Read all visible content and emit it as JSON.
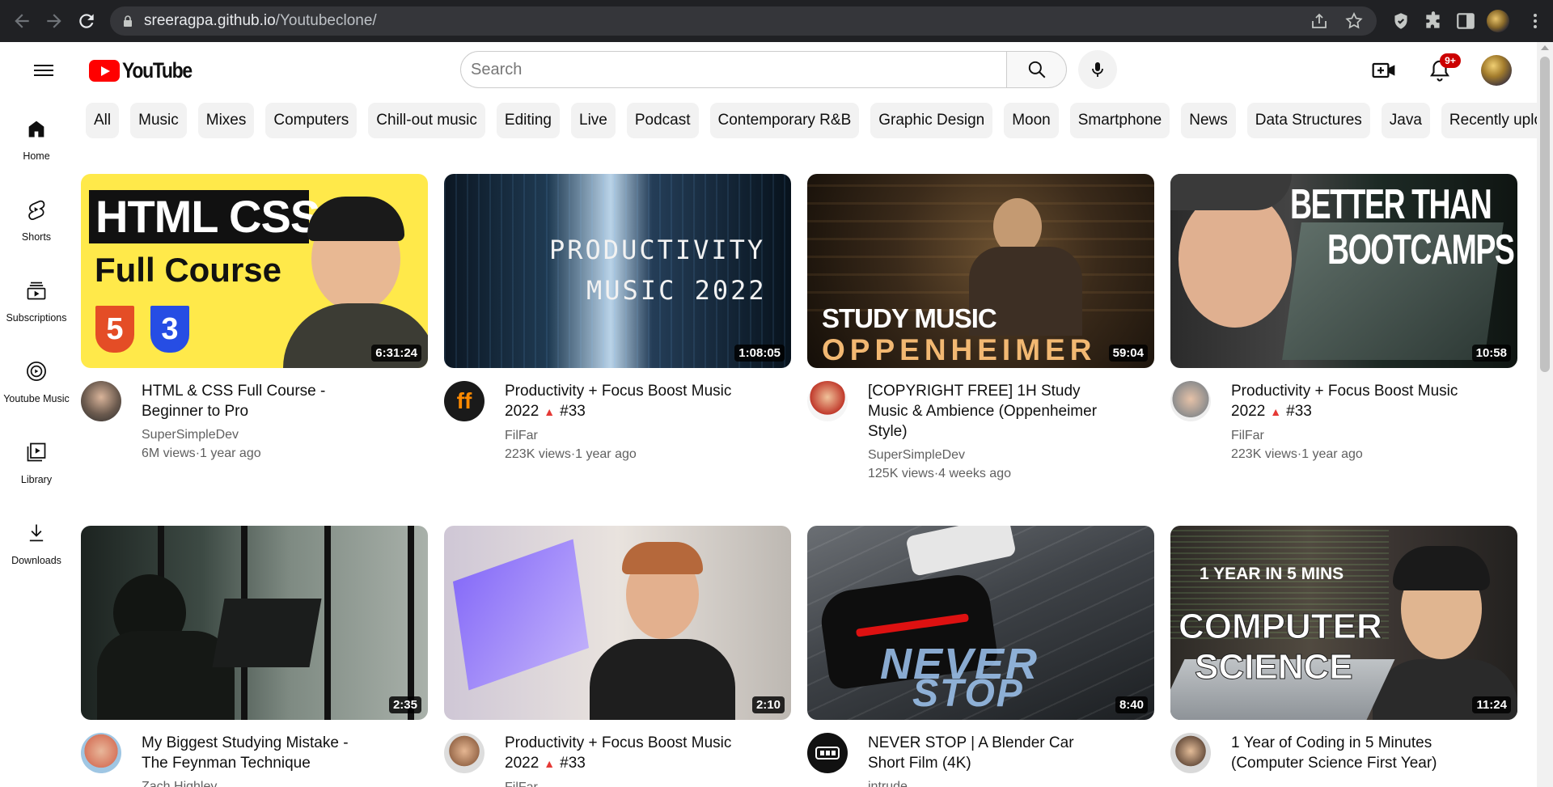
{
  "browser": {
    "url_host": "sreeragpa.github.io",
    "url_path": "/Youtubeclone/"
  },
  "header": {
    "logo_text": "YouTube",
    "search_placeholder": "Search",
    "notification_badge": "9+"
  },
  "chips": [
    "All",
    "Music",
    "Mixes",
    "Computers",
    "Chill-out music",
    "Editing",
    "Live",
    "Podcast",
    "Contemporary R&B",
    "Graphic Design",
    "Moon",
    "Smartphone",
    "News",
    "Data Structures",
    "Java",
    "Recently upload"
  ],
  "sidebar": {
    "items": [
      {
        "label": "Home",
        "icon": "home-icon"
      },
      {
        "label": "Shorts",
        "icon": "shorts-icon"
      },
      {
        "label": "Subscriptions",
        "icon": "subscriptions-icon"
      },
      {
        "label": "Youtube Music",
        "icon": "music-icon"
      },
      {
        "label": "Library",
        "icon": "library-icon"
      },
      {
        "label": "Downloads",
        "icon": "download-icon"
      }
    ]
  },
  "videos": [
    {
      "title": "HTML & CSS Full Course - Beginner to Pro",
      "channel": "SuperSimpleDev",
      "views": "6M views",
      "age": "1 year ago",
      "duration": "6:31:24",
      "thumb_text": [
        "HTML CSS",
        "Full Course"
      ],
      "badges": [
        "5",
        "3"
      ]
    },
    {
      "title": "Productivity + Focus Boost Music 2022",
      "title_suffix": "#33",
      "channel": "FilFar",
      "views": "223K views",
      "age": "1 year ago",
      "duration": "1:08:05",
      "thumb_text": [
        "PRODUCTIVITY",
        "MUSIC 2022"
      ]
    },
    {
      "title": "[COPYRIGHT FREE] 1H Study Music & Ambience (Oppenheimer Style)",
      "channel": "SuperSimpleDev",
      "views": "125K views",
      "age": "4 weeks ago",
      "duration": "59:04",
      "thumb_text": [
        "STUDY MUSIC",
        "OPPENHEIMER"
      ]
    },
    {
      "title": "Productivity + Focus Boost Music 2022",
      "title_suffix": "#33",
      "channel": "FilFar",
      "views": "223K views",
      "age": "1 year ago",
      "duration": "10:58",
      "thumb_text": [
        "BETTER THAN",
        "BOOTCAMPS"
      ]
    },
    {
      "title": "My Biggest Studying Mistake - The Feynman Technique",
      "channel": "Zach Highley",
      "duration": "2:35"
    },
    {
      "title": "Productivity + Focus Boost Music 2022",
      "title_suffix": "#33",
      "channel": "FilFar",
      "duration": "2:10"
    },
    {
      "title": "NEVER STOP | A Blender Car Short Film (4K)",
      "channel": "intrude",
      "duration": "8:40",
      "thumb_text": [
        "NEVER",
        "STOP"
      ]
    },
    {
      "title": "1 Year of Coding in 5 Minutes (Computer Science First Year)",
      "duration": "11:24",
      "thumb_text": [
        "1 YEAR IN 5 MINS",
        "COMPUTER",
        "SCIENCE"
      ]
    }
  ],
  "colors": {
    "brand_red": "#ff0000",
    "chrome_bg": "#202124",
    "chip_bg": "#f2f2f2",
    "meta_text": "#606060"
  }
}
